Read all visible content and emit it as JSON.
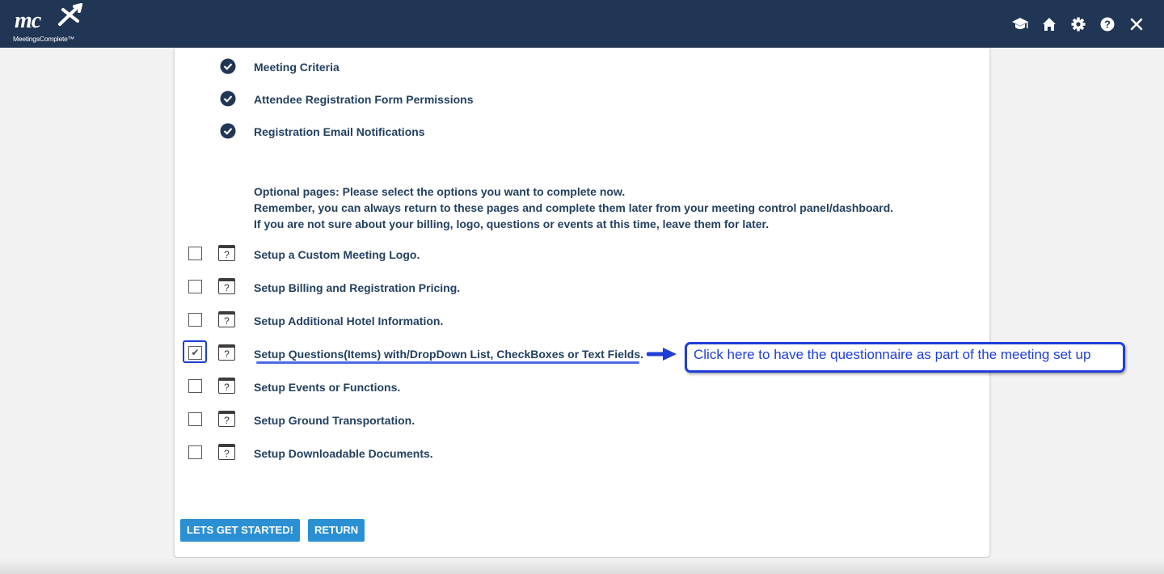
{
  "header": {
    "logo_mark": "mc",
    "logo_text": "MeetingsComplete™",
    "icons": [
      "graduation-cap-icon",
      "home-icon",
      "gear-icon",
      "help-icon",
      "close-icon"
    ],
    "background": "#213554"
  },
  "completed": [
    {
      "label": "Meeting Criteria"
    },
    {
      "label": "Attendee Registration Form Permissions"
    },
    {
      "label": "Registration Email Notifications"
    }
  ],
  "intro": {
    "line1": "Optional pages: Please select the options you want to complete now.",
    "line2": "Remember, you can always return to these pages and complete them later from your meeting control panel/dashboard.",
    "line3": "If you are not sure about your billing, logo, questions or events at this time, leave them for later."
  },
  "options": [
    {
      "label": "Setup a Custom Meeting Logo.",
      "checked": false,
      "help": "?"
    },
    {
      "label": "Setup Billing and Registration Pricing.",
      "checked": false,
      "help": "?"
    },
    {
      "label": "Setup Additional Hotel Information.",
      "checked": false,
      "help": "?"
    },
    {
      "label": "Setup Questions(Items) with/DropDown List, CheckBoxes or Text Fields.",
      "checked": true,
      "check_mark": "✔",
      "help": "?"
    },
    {
      "label": "Setup Events or Functions.",
      "checked": false,
      "help": "?"
    },
    {
      "label": "Setup Ground Transportation.",
      "checked": false,
      "help": "?"
    },
    {
      "label": "Setup Downloadable Documents.",
      "checked": false,
      "help": "?"
    }
  ],
  "annotation": {
    "callout_text": "Click here to have the questionnaire as part of the meeting set up",
    "color": "#1f3ed8"
  },
  "buttons": {
    "start": "LETS GET STARTED!",
    "return": "RETURN",
    "color": "#2b8fd3"
  }
}
